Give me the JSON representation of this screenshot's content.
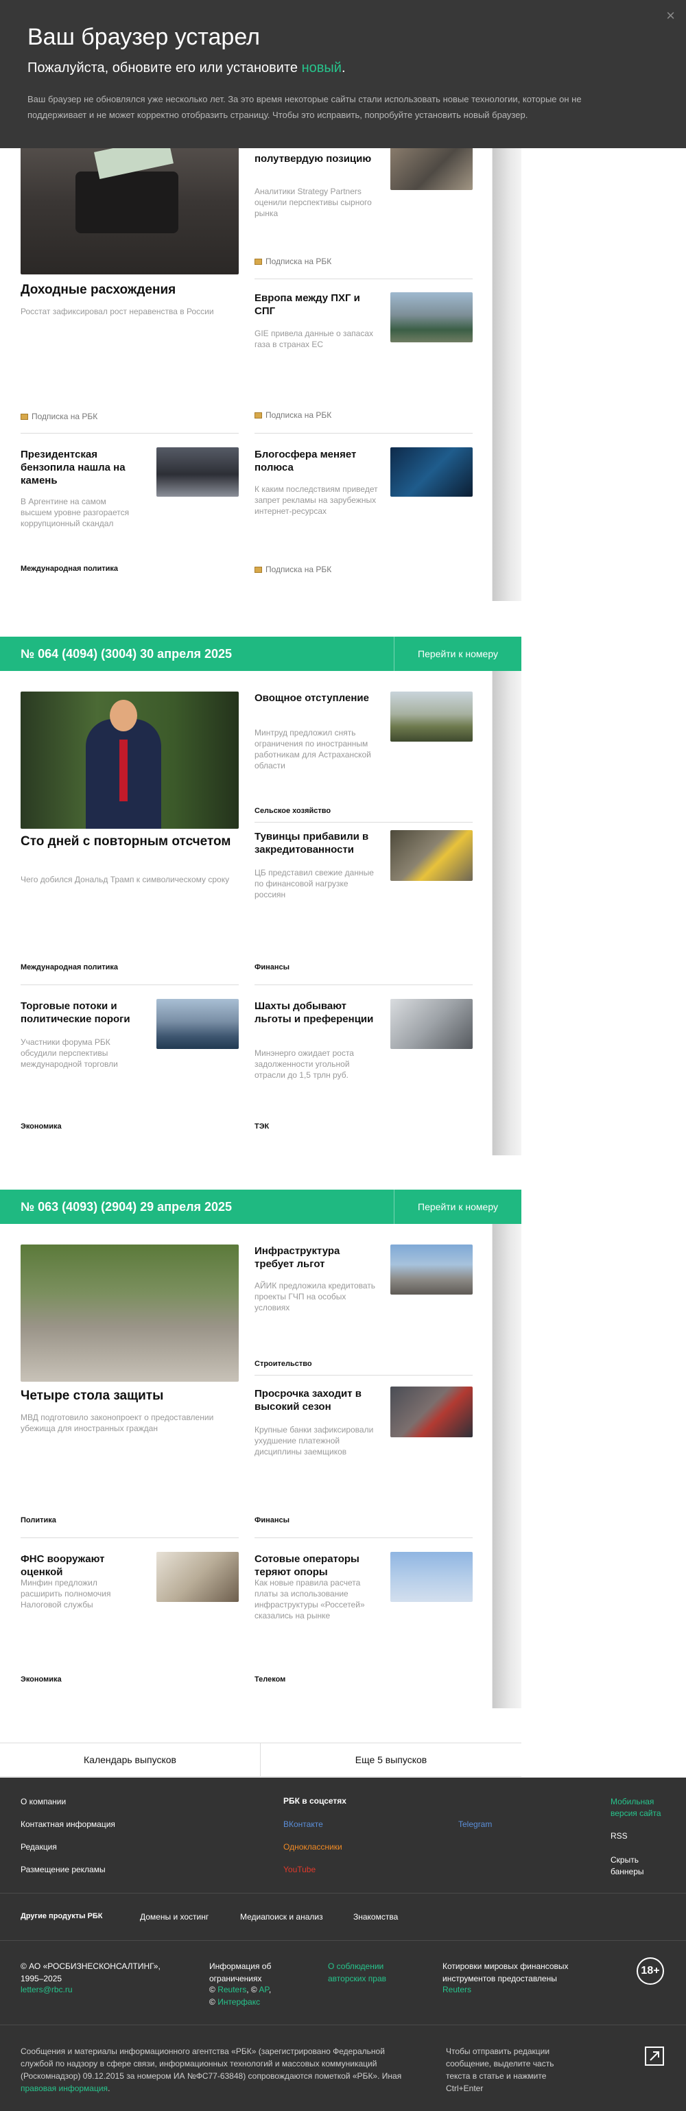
{
  "banner": {
    "title": "Ваш браузер устарел",
    "sub_before": "Пожалуйста, обновите его или установите ",
    "sub_link": "новый",
    "sub_after": ".",
    "desc": "Ваш браузер не обновлялся уже несколько лет. За это время некоторые сайты стали использовать новые технологии, которые он не поддерживает и не может корректно отобразить страницу. Чтобы это исправить, попробуйте установить новый браузер.",
    "close": "×"
  },
  "issue0": {
    "main": {
      "title": "Доходные расхождения",
      "desc": "Росстат зафиксировал рост неравенства в России",
      "tag": "Подписка на РБК"
    },
    "a1": {
      "title": "полутвердую позицию",
      "desc": "Аналитики Strategy Partners оценили перспективы сырного рынка",
      "tag": "Подписка на РБК"
    },
    "a2": {
      "title": "Европа между ПХГ и СПГ",
      "desc": "GIE привела данные о запасах газа в странах ЕС",
      "tag": "Подписка на РБК"
    },
    "a3": {
      "title": "Президентская бензопила нашла на камень",
      "desc": "В Аргентине на самом высшем уровне разгорается коррупционный скандал",
      "tag": "Международная политика"
    },
    "a4": {
      "title": "Блогосфера меняет полюса",
      "desc": "К каким последствиям приведет запрет рекламы на зарубежных интернет-ресурсах",
      "tag": "Подписка на РБК"
    }
  },
  "issue1": {
    "header": "№ 064 (4094) (3004)  30 апреля 2025",
    "go": "Перейти к номеру",
    "main": {
      "title": "Сто дней с повторным отсчетом",
      "desc": "Чего добился Дональд Трамп к символическому сроку",
      "tag": "Международная политика"
    },
    "a1": {
      "title": "Овощное отступление",
      "desc": "Минтруд предложил снять ограничения по иностранным работникам для Астраханской области",
      "tag": "Сельское хозяйство"
    },
    "a2": {
      "title": "Тувинцы прибавили в закредитованности",
      "desc": "ЦБ представил свежие данные по финансовой нагрузке россиян",
      "tag": "Финансы"
    },
    "a3": {
      "title": "Торговые потоки и политические пороги",
      "desc": "Участники форума РБК обсудили перспективы международной торговли",
      "tag": "Экономика"
    },
    "a4": {
      "title": "Шахты добывают льготы и преференции",
      "desc": "Минэнерго ожидает роста задолженности угольной отрасли до 1,5 трлн руб.",
      "tag": "ТЭК"
    }
  },
  "issue2": {
    "header": "№ 063 (4093) (2904)  29 апреля 2025",
    "go": "Перейти к номеру",
    "main": {
      "title": "Четыре стола защиты",
      "desc": "МВД подготовило законопроект о предоставлении убежища для иностранных граждан",
      "tag": "Политика"
    },
    "a1": {
      "title": "Инфраструктура требует льгот",
      "desc": "АЙИК предложила кредитовать проекты ГЧП на особых условиях",
      "tag": "Строительство"
    },
    "a2": {
      "title": "Просрочка заходит в высокий сезон",
      "desc": "Крупные банки зафиксировали ухудшение платежной дисциплины заемщиков",
      "tag": "Финансы"
    },
    "a3": {
      "title": "ФНС вооружают оценкой",
      "desc": "Минфин предложил расширить полномочия Налоговой службы",
      "tag": "Экономика"
    },
    "a4": {
      "title": "Сотовые операторы теряют опоры",
      "desc": "Как новые правила расчета платы за использование инфраструктуры «Россетей» сказались на рынке",
      "tag": "Телеком"
    }
  },
  "bottom": {
    "calendar": "Календарь выпусков",
    "more": "Еще 5 выпусков"
  },
  "footer": {
    "links": [
      "О компании",
      "Контактная информация",
      "Редакция",
      "Размещение рекламы"
    ],
    "social_title": "РБК в соцсетях",
    "social": {
      "vk": "ВКонтакте",
      "telegram": "Telegram",
      "ok": "Одноклассники",
      "youtube": "YouTube"
    },
    "right": {
      "mobile": "Мобильная версия сайта",
      "rss": "RSS",
      "hide": "Скрыть баннеры"
    },
    "products_title": "Другие продукты РБК",
    "products": [
      "Домены и хостинг",
      "Медиапоиск и анализ",
      "Знакомства"
    ],
    "copyright": "© АО «РОСБИЗНЕСКОНСАЛТИНГ», 1995–2025",
    "email": "letters@rbc.ru",
    "info_title": "Информация об ограничениях",
    "info_sources_prefix": "© ",
    "reuters": "Reuters",
    "ap": "AP",
    "interfax": "Интерфакс",
    "rights": "О соблюдении авторских прав",
    "quotes": "Котировки мировых финансовых инструментов предоставлены",
    "quotes_src": "Reuters",
    "age": "18+",
    "legal": "Сообщения и материалы информационного агентства «РБК» (зарегистрировано Федеральной службой по надзору в сфере связи, информационных технологий и массовых коммуникаций (Роскомнадзор) 09.12.2015 за номером ИА №ФС77-63848) сопровождаются пометкой «РБК». Иная",
    "legal_link": "правовая информация",
    "error_hint": "Чтобы отправить редакции сообщение, выделите часть текста в статье и нажмите Ctrl+Enter"
  },
  "colors": {
    "accent": "#1fb981",
    "banner_bg": "#383838",
    "footer_bg": "#333333"
  }
}
